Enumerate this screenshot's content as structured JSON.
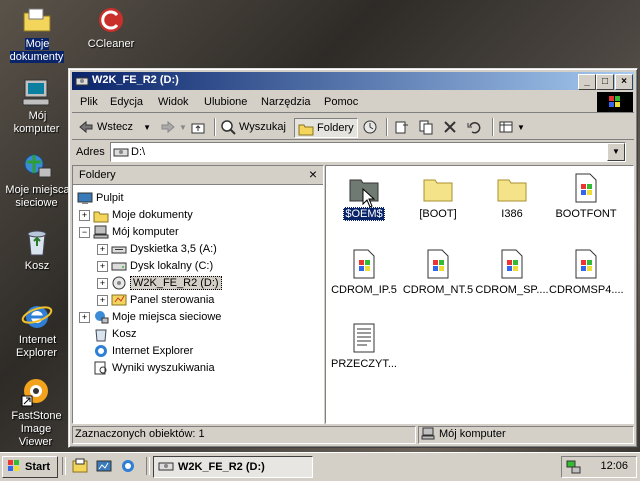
{
  "desktop": {
    "icons": [
      {
        "label": "Moje dokumenty"
      },
      {
        "label": "CCleaner"
      },
      {
        "label": "Mój komputer"
      },
      {
        "label": "Moje miejsca sieciowe"
      },
      {
        "label": "Kosz"
      },
      {
        "label": "Internet Explorer"
      },
      {
        "label": "FastStone Image Viewer"
      }
    ]
  },
  "window": {
    "title": "W2K_FE_R2 (D:)",
    "buttons": {
      "minimize": "_",
      "maximize": "□",
      "close": "×"
    },
    "menu": [
      "Plik",
      "Edycja",
      "Widok",
      "Ulubione",
      "Narzędzia",
      "Pomoc"
    ],
    "toolbar": {
      "back": "Wstecz",
      "search": "Wyszukaj",
      "folders": "Foldery"
    },
    "address": {
      "label": "Adres",
      "value": "D:\\"
    },
    "folders_pane": {
      "title": "Foldery",
      "close": "×",
      "tree": [
        {
          "label": "Pulpit"
        },
        {
          "label": "Moje dokumenty"
        },
        {
          "label": "Mój komputer"
        },
        {
          "label": "Dyskietka 3,5 (A:)"
        },
        {
          "label": "Dysk lokalny (C:)"
        },
        {
          "label": "W2K_FE_R2 (D:)"
        },
        {
          "label": "Panel sterowania"
        },
        {
          "label": "Moje miejsca sieciowe"
        },
        {
          "label": "Kosz"
        },
        {
          "label": "Internet Explorer"
        },
        {
          "label": "Wyniki wyszukiwania"
        }
      ]
    },
    "files": [
      {
        "name": "$OEM$",
        "type": "folder-dark"
      },
      {
        "name": "[BOOT]",
        "type": "folder"
      },
      {
        "name": "I386",
        "type": "folder"
      },
      {
        "name": "BOOTFONT",
        "type": "file"
      },
      {
        "name": "CDROM_IP.5",
        "type": "file"
      },
      {
        "name": "CDROM_NT.5",
        "type": "file"
      },
      {
        "name": "CDROM_SP....",
        "type": "file"
      },
      {
        "name": "CDROMSP4....",
        "type": "file"
      },
      {
        "name": "PRZECZYT...",
        "type": "text"
      }
    ],
    "status": {
      "selected": "Zaznaczonych obiektów: 1",
      "location": "Mój komputer"
    }
  },
  "taskbar": {
    "start": "Start",
    "task": "W2K_FE_R2 (D:)",
    "clock": "12:06"
  }
}
